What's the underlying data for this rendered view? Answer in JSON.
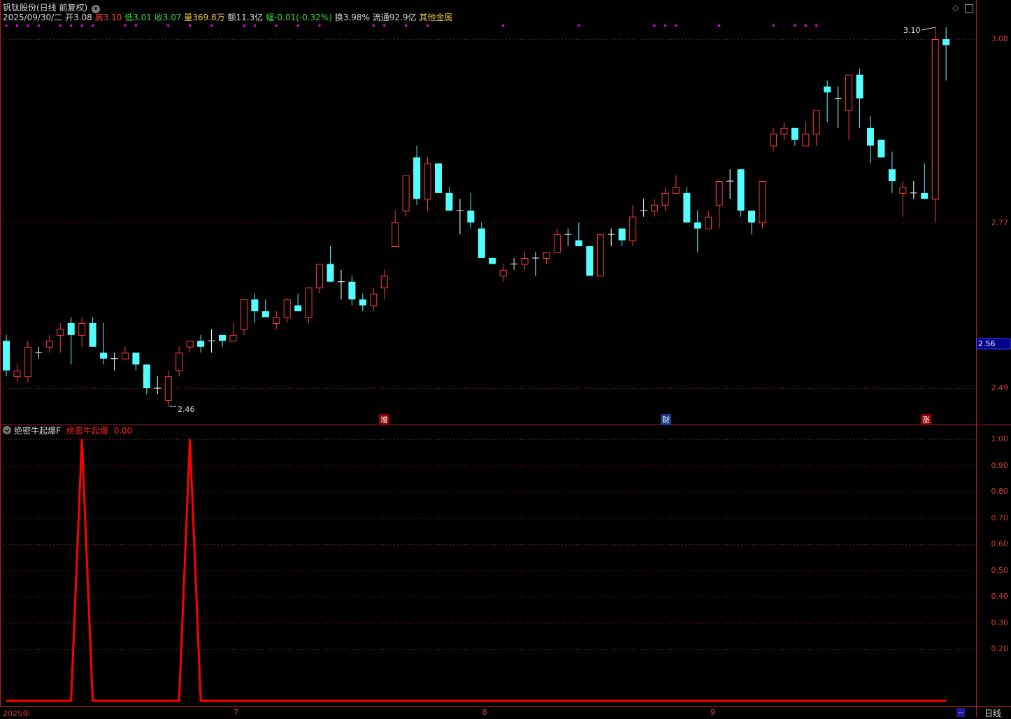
{
  "header": {
    "title": "钒钛股份(日线 前复权)",
    "date": "2025/09/30/二",
    "open_label": "开",
    "open": "3.08",
    "high_label": "高",
    "high": "3.10",
    "low_label": "低",
    "low": "3.01",
    "close_label": "收",
    "close": "3.07",
    "vol_label": "量",
    "vol": "369.8万",
    "amt_label": "额",
    "amt": "11.3亿",
    "chg_label": "幅",
    "chg": "-0.01(-0.32%)",
    "turn_label": "换",
    "turn": "3.98%",
    "float_label": "流通",
    "float": "92.9亿",
    "sector": "其他金属"
  },
  "price_axis": {
    "ticks": [
      "3.08",
      "2.77",
      "2.49"
    ],
    "current": "2.56"
  },
  "markers": {
    "high_note": "3.10",
    "low_note": "2.46"
  },
  "events": [
    {
      "label": "增"
    },
    {
      "label": "财"
    },
    {
      "label": "涨"
    }
  ],
  "indicator": {
    "name": "绝密牛起爆F",
    "series_name": "绝密牛起爆",
    "value": "0.00",
    "ticks": [
      "1.00",
      "0.90",
      "0.80",
      "0.70",
      "0.60",
      "0.50",
      "0.40",
      "0.30",
      "0.20"
    ]
  },
  "time_axis": {
    "labels": [
      "2025年",
      "7",
      "8",
      "9"
    ],
    "period": "日线",
    "more": "--"
  },
  "colors": {
    "up": "#ff3c3c",
    "down": "#54ffff",
    "flat": "#ffffff",
    "grid": "#8a1f1f",
    "signal": "#ff0000",
    "dots": "#ff00ff"
  },
  "chart_data": [
    {
      "type": "candlestick",
      "title": "钒钛股份(日线 前复权)",
      "ylim": [
        2.42,
        3.12
      ],
      "yticks": [
        3.08,
        2.77,
        2.49
      ],
      "candles": [
        [
          2.57,
          2.58,
          2.51,
          2.52
        ],
        [
          2.51,
          2.53,
          2.5,
          2.52
        ],
        [
          2.51,
          2.57,
          2.5,
          2.56
        ],
        [
          2.55,
          2.56,
          2.54,
          2.55
        ],
        [
          2.56,
          2.58,
          2.55,
          2.57
        ],
        [
          2.58,
          2.6,
          2.55,
          2.59
        ],
        [
          2.6,
          2.61,
          2.53,
          2.58
        ],
        [
          2.58,
          2.61,
          2.56,
          2.6
        ],
        [
          2.6,
          2.61,
          2.56,
          2.56
        ],
        [
          2.55,
          2.6,
          2.53,
          2.54
        ],
        [
          2.54,
          2.55,
          2.52,
          2.54
        ],
        [
          2.54,
          2.56,
          2.54,
          2.55
        ],
        [
          2.55,
          2.55,
          2.52,
          2.53
        ],
        [
          2.53,
          2.53,
          2.48,
          2.49
        ],
        [
          2.49,
          2.51,
          2.48,
          2.49
        ],
        [
          2.47,
          2.52,
          2.46,
          2.51
        ],
        [
          2.52,
          2.56,
          2.51,
          2.55
        ],
        [
          2.56,
          2.57,
          2.55,
          2.57
        ],
        [
          2.57,
          2.58,
          2.55,
          2.56
        ],
        [
          2.57,
          2.59,
          2.55,
          2.57
        ],
        [
          2.58,
          2.58,
          2.56,
          2.57
        ],
        [
          2.57,
          2.6,
          2.57,
          2.58
        ],
        [
          2.59,
          2.63,
          2.58,
          2.64
        ],
        [
          2.64,
          2.65,
          2.6,
          2.62
        ],
        [
          2.62,
          2.64,
          2.61,
          2.61
        ],
        [
          2.6,
          2.62,
          2.59,
          2.61
        ],
        [
          2.61,
          2.63,
          2.6,
          2.64
        ],
        [
          2.63,
          2.65,
          2.62,
          2.62
        ],
        [
          2.61,
          2.66,
          2.6,
          2.66
        ],
        [
          2.66,
          2.7,
          2.65,
          2.7
        ],
        [
          2.7,
          2.73,
          2.68,
          2.67
        ],
        [
          2.67,
          2.69,
          2.64,
          2.67
        ],
        [
          2.67,
          2.68,
          2.63,
          2.64
        ],
        [
          2.64,
          2.65,
          2.62,
          2.63
        ],
        [
          2.63,
          2.66,
          2.62,
          2.65
        ],
        [
          2.66,
          2.69,
          2.64,
          2.68
        ],
        [
          2.73,
          2.79,
          2.73,
          2.77
        ],
        [
          2.79,
          2.85,
          2.78,
          2.85
        ],
        [
          2.88,
          2.9,
          2.8,
          2.81
        ],
        [
          2.81,
          2.88,
          2.79,
          2.87
        ],
        [
          2.87,
          2.87,
          2.82,
          2.82
        ],
        [
          2.82,
          2.83,
          2.79,
          2.79
        ],
        [
          2.79,
          2.81,
          2.75,
          2.79
        ],
        [
          2.79,
          2.82,
          2.76,
          2.77
        ],
        [
          2.76,
          2.77,
          2.71,
          2.71
        ],
        [
          2.71,
          2.71,
          2.7,
          2.7
        ],
        [
          2.68,
          2.7,
          2.67,
          2.69
        ],
        [
          2.7,
          2.71,
          2.69,
          2.7
        ],
        [
          2.7,
          2.72,
          2.69,
          2.71
        ],
        [
          2.71,
          2.72,
          2.68,
          2.71
        ],
        [
          2.71,
          2.72,
          2.7,
          2.72
        ],
        [
          2.72,
          2.76,
          2.72,
          2.75
        ],
        [
          2.75,
          2.76,
          2.73,
          2.75
        ],
        [
          2.74,
          2.77,
          2.74,
          2.73
        ],
        [
          2.73,
          2.73,
          2.7,
          2.68
        ],
        [
          2.68,
          2.75,
          2.68,
          2.75
        ],
        [
          2.75,
          2.76,
          2.73,
          2.75
        ],
        [
          2.76,
          2.76,
          2.73,
          2.74
        ],
        [
          2.74,
          2.8,
          2.73,
          2.78
        ],
        [
          2.79,
          2.81,
          2.78,
          2.79
        ],
        [
          2.79,
          2.81,
          2.78,
          2.8
        ],
        [
          2.8,
          2.83,
          2.79,
          2.82
        ],
        [
          2.82,
          2.85,
          2.82,
          2.83
        ],
        [
          2.82,
          2.83,
          2.78,
          2.77
        ],
        [
          2.77,
          2.79,
          2.72,
          2.76
        ],
        [
          2.76,
          2.79,
          2.76,
          2.78
        ],
        [
          2.8,
          2.84,
          2.76,
          2.84
        ],
        [
          2.84,
          2.86,
          2.81,
          2.84
        ],
        [
          2.86,
          2.86,
          2.78,
          2.79
        ],
        [
          2.79,
          2.79,
          2.75,
          2.77
        ],
        [
          2.77,
          2.84,
          2.76,
          2.84
        ],
        [
          2.9,
          2.93,
          2.89,
          2.92
        ],
        [
          2.92,
          2.94,
          2.91,
          2.93
        ],
        [
          2.93,
          2.93,
          2.9,
          2.91
        ],
        [
          2.9,
          2.94,
          2.9,
          2.92
        ],
        [
          2.92,
          2.95,
          2.9,
          2.96
        ],
        [
          3.0,
          3.01,
          2.94,
          2.99
        ],
        [
          2.98,
          3.0,
          2.93,
          2.98
        ],
        [
          2.96,
          3.0,
          2.91,
          3.02
        ],
        [
          3.02,
          3.03,
          2.93,
          2.98
        ],
        [
          2.93,
          2.95,
          2.87,
          2.9
        ],
        [
          2.91,
          2.91,
          2.89,
          2.88
        ],
        [
          2.86,
          2.89,
          2.82,
          2.84
        ],
        [
          2.82,
          2.84,
          2.78,
          2.83
        ],
        [
          2.82,
          2.84,
          2.81,
          2.82
        ],
        [
          2.82,
          2.87,
          2.81,
          2.81
        ],
        [
          2.81,
          3.1,
          2.77,
          3.08
        ],
        [
          3.08,
          3.1,
          3.01,
          3.07
        ]
      ],
      "event_labels": [
        "增",
        "财",
        "涨"
      ]
    },
    {
      "type": "line",
      "title": "绝密牛起爆F",
      "series": [
        {
          "name": "绝密牛起爆",
          "values": [
            0,
            0,
            0,
            0,
            0,
            0,
            0,
            1,
            0,
            0,
            0,
            0,
            0,
            0,
            0,
            0,
            0,
            1,
            0,
            0,
            0,
            0,
            0,
            0,
            0,
            0,
            0,
            0,
            0,
            0,
            0,
            0,
            0,
            0,
            0,
            0,
            0,
            0,
            0,
            0,
            0,
            0,
            0,
            0,
            0,
            0,
            0,
            0,
            0,
            0,
            0,
            0,
            0,
            0,
            0,
            0,
            0,
            0,
            0,
            0,
            0,
            0,
            0,
            0,
            0,
            0,
            0,
            0,
            0,
            0,
            0,
            0,
            0,
            0,
            0,
            0,
            0,
            0,
            0,
            0,
            0,
            0,
            0,
            0,
            0,
            0,
            0,
            0
          ]
        }
      ],
      "ylim": [
        0,
        1
      ],
      "yticks": [
        1.0,
        0.9,
        0.8,
        0.7,
        0.6,
        0.5,
        0.4,
        0.3,
        0.2
      ]
    }
  ]
}
